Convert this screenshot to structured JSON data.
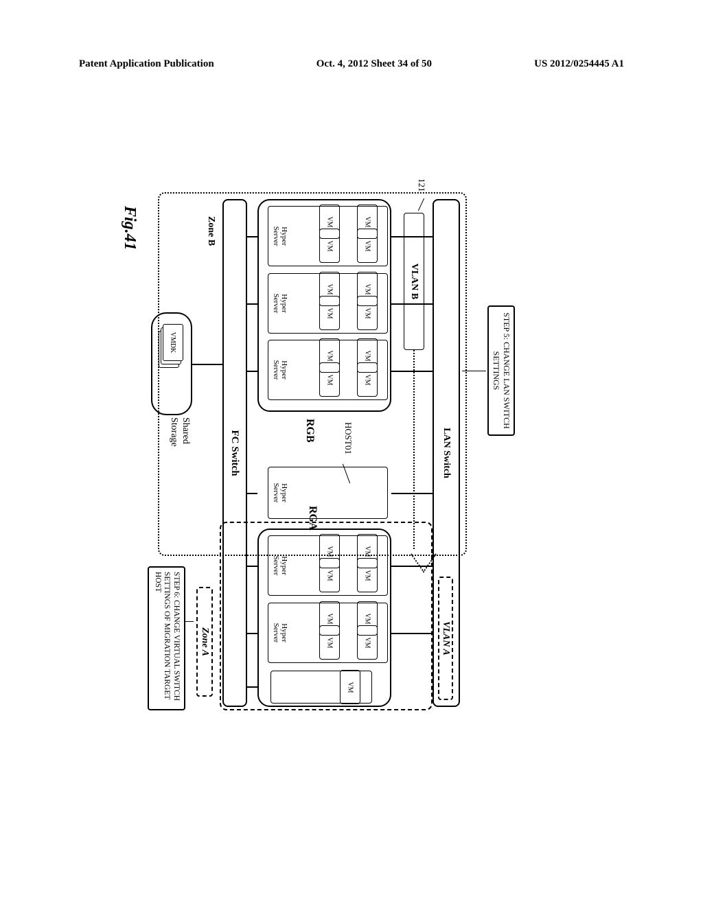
{
  "header": {
    "left": "Patent Application Publication",
    "center": "Oct. 4, 2012  Sheet 34 of 50",
    "right": "US 2012/0254445 A1"
  },
  "step5": "STEP 5: CHANGE LAN SWITCH SETTINGS",
  "step6": "STEP 6: CHANGE VIRTUAL SWITCH SETTINGS OF MIGRATION TARGET HOST",
  "lan_switch": "LAN Switch",
  "fc_switch": "FC Switch",
  "vlan_a": "VLAN A",
  "vlan_b": "VLAN B",
  "zone_a": "Zone A",
  "zone_b": "Zone B",
  "rgb": "RGB",
  "rga": "RGA",
  "host01": "HOST01",
  "label_121": "121",
  "hyper": "Hyper",
  "server": "Server",
  "vm": "VM",
  "vmdk": "VMDK",
  "shared_storage_1": "Shared",
  "shared_storage_2": "Storage",
  "fig": "Fig.41"
}
